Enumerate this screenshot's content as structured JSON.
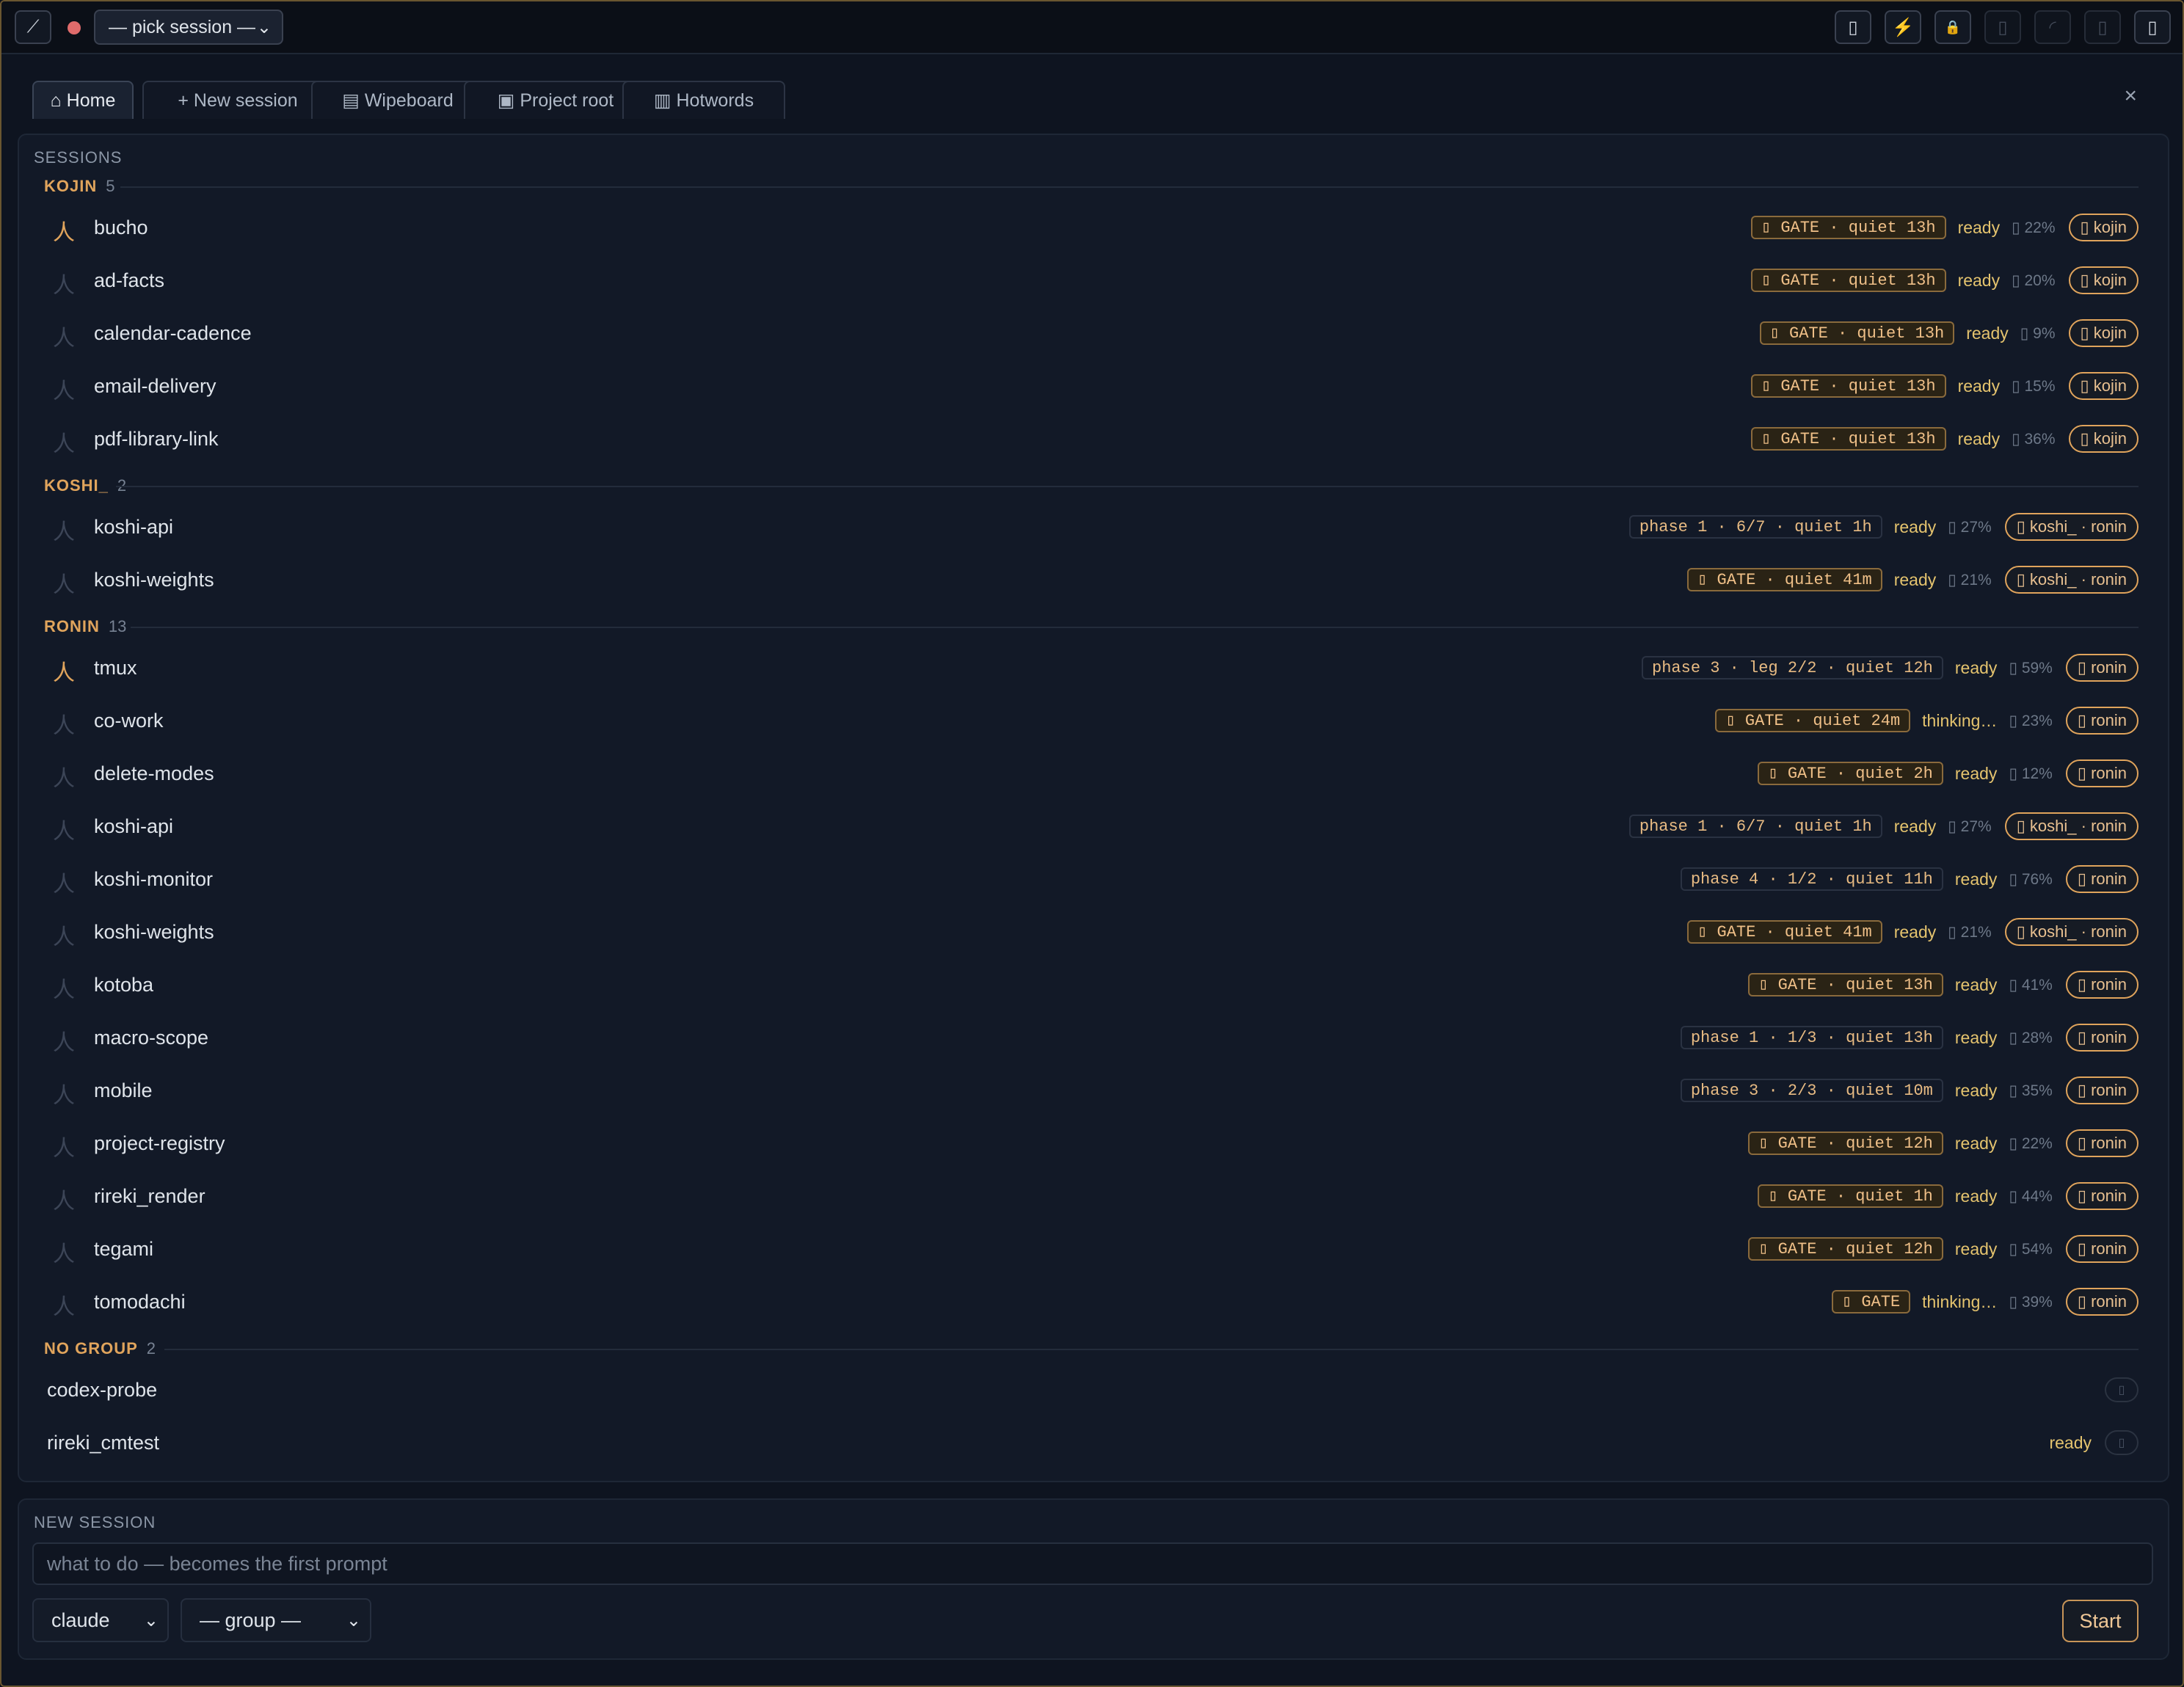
{
  "topbar": {
    "logo_icon": "⟋",
    "session_picker": "— pick session —",
    "icons": [
      "panel-icon",
      "bolt-icon",
      "lock-icon",
      "blank-icon",
      "spinner-icon",
      "blank-icon",
      "panel-right-icon"
    ]
  },
  "tabs": [
    {
      "label": "⌂ Home"
    },
    {
      "label": "+ New session"
    },
    {
      "label": "▤ Wipeboard"
    },
    {
      "label": "▣ Project root"
    },
    {
      "label": "▥ Hotwords"
    }
  ],
  "close_label": "×",
  "sessions": {
    "title": "SESSIONS",
    "groups": [
      {
        "name": "KOJIN",
        "count": "5",
        "rows": [
          {
            "name": "bucho",
            "active": true,
            "badge": "▯ GATE · quiet 13h",
            "badge_type": "gate",
            "status": "ready",
            "pct": "▯ 22%",
            "group": "▯ kojin"
          },
          {
            "name": "ad-facts",
            "active": false,
            "badge": "▯ GATE · quiet 13h",
            "badge_type": "gate",
            "status": "ready",
            "pct": "▯ 20%",
            "group": "▯ kojin"
          },
          {
            "name": "calendar-cadence",
            "active": false,
            "badge": "▯ GATE · quiet 13h",
            "badge_type": "gate",
            "status": "ready",
            "pct": "▯ 9%",
            "group": "▯ kojin"
          },
          {
            "name": "email-delivery",
            "active": false,
            "badge": "▯ GATE · quiet 13h",
            "badge_type": "gate",
            "status": "ready",
            "pct": "▯ 15%",
            "group": "▯ kojin"
          },
          {
            "name": "pdf-library-link",
            "active": false,
            "badge": "▯ GATE · quiet 13h",
            "badge_type": "gate",
            "status": "ready",
            "pct": "▯ 36%",
            "group": "▯ kojin"
          }
        ]
      },
      {
        "name": "KOSHI_",
        "count": "2",
        "rows": [
          {
            "name": "koshi-api",
            "active": false,
            "badge": "phase 1 · 6/7 · quiet 1h",
            "badge_type": "phase",
            "status": "ready",
            "pct": "▯ 27%",
            "group": "▯ koshi_ · ronin"
          },
          {
            "name": "koshi-weights",
            "active": false,
            "badge": "▯ GATE · quiet 41m",
            "badge_type": "gate",
            "status": "ready",
            "pct": "▯ 21%",
            "group": "▯ koshi_ · ronin"
          }
        ]
      },
      {
        "name": "RONIN",
        "count": "13",
        "rows": [
          {
            "name": "tmux",
            "active": true,
            "badge": "phase 3 · leg 2/2 · quiet 12h",
            "badge_type": "phase",
            "status": "ready",
            "pct": "▯ 59%",
            "group": "▯ ronin"
          },
          {
            "name": "co-work",
            "active": false,
            "badge": "▯ GATE · quiet 24m",
            "badge_type": "gate",
            "status": "thinking…",
            "pct": "▯ 23%",
            "group": "▯ ronin"
          },
          {
            "name": "delete-modes",
            "active": false,
            "badge": "▯ GATE · quiet 2h",
            "badge_type": "gate",
            "status": "ready",
            "pct": "▯ 12%",
            "group": "▯ ronin"
          },
          {
            "name": "koshi-api",
            "active": false,
            "badge": "phase 1 · 6/7 · quiet 1h",
            "badge_type": "phase",
            "status": "ready",
            "pct": "▯ 27%",
            "group": "▯ koshi_ · ronin"
          },
          {
            "name": "koshi-monitor",
            "active": false,
            "badge": "phase 4 · 1/2 · quiet 11h",
            "badge_type": "phase",
            "status": "ready",
            "pct": "▯ 76%",
            "group": "▯ ronin"
          },
          {
            "name": "koshi-weights",
            "active": false,
            "badge": "▯ GATE · quiet 41m",
            "badge_type": "gate",
            "status": "ready",
            "pct": "▯ 21%",
            "group": "▯ koshi_ · ronin"
          },
          {
            "name": "kotoba",
            "active": false,
            "badge": "▯ GATE · quiet 13h",
            "badge_type": "gate",
            "status": "ready",
            "pct": "▯ 41%",
            "group": "▯ ronin"
          },
          {
            "name": "macro-scope",
            "active": false,
            "badge": "phase 1 · 1/3 · quiet 13h",
            "badge_type": "phase",
            "status": "ready",
            "pct": "▯ 28%",
            "group": "▯ ronin"
          },
          {
            "name": "mobile",
            "active": false,
            "badge": "phase 3 · 2/3 · quiet 10m",
            "badge_type": "phase",
            "status": "ready",
            "pct": "▯ 35%",
            "group": "▯ ronin"
          },
          {
            "name": "project-registry",
            "active": false,
            "badge": "▯ GATE · quiet 12h",
            "badge_type": "gate",
            "status": "ready",
            "pct": "▯ 22%",
            "group": "▯ ronin"
          },
          {
            "name": "rireki_render",
            "active": false,
            "badge": "▯ GATE · quiet 1h",
            "badge_type": "gate",
            "status": "ready",
            "pct": "▯ 44%",
            "group": "▯ ronin"
          },
          {
            "name": "tegami",
            "active": false,
            "badge": "▯ GATE · quiet 12h",
            "badge_type": "gate",
            "status": "ready",
            "pct": "▯ 54%",
            "group": "▯ ronin"
          },
          {
            "name": "tomodachi",
            "active": false,
            "badge": "▯ GATE",
            "badge_type": "gate",
            "status": "thinking…",
            "pct": "▯ 39%",
            "group": "▯ ronin"
          }
        ]
      },
      {
        "name": "NO GROUP",
        "count": "2",
        "rows": [
          {
            "name": "codex-probe",
            "plain": true,
            "status": "",
            "empty_pill": "▯"
          },
          {
            "name": "rireki_cmtest",
            "plain": true,
            "status": "ready",
            "empty_pill": "▯"
          }
        ]
      }
    ]
  },
  "new_session": {
    "title": "NEW SESSION",
    "prompt_placeholder": "what to do — becomes the first prompt",
    "agent_select": "claude",
    "group_select": "— group —",
    "start_label": "Start"
  },
  "colors": {
    "accent": "#e0a45c",
    "status": "#e4c36e",
    "bg": "#0e1420"
  }
}
